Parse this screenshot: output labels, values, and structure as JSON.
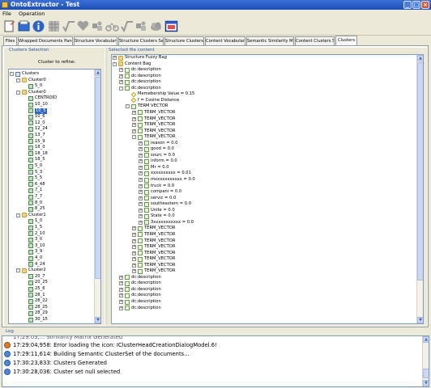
{
  "window": {
    "title": "OntoExtractor - Test"
  },
  "menu": [
    "File",
    "Operation"
  ],
  "toolbar": {
    "icons": [
      "new-document-icon",
      "open-folder-icon",
      "info-icon",
      "grid-icon",
      "sqrt-icon",
      "heart-icon",
      "puzzle-icon",
      "bike-icon",
      "sqrt-icon",
      "puzzle-icon",
      "cloud-icon",
      "window-icon"
    ]
  },
  "tabs": [
    "Files",
    "Wrapped Documents Panel",
    "Structure Vocabulary",
    "Structure Clusters Set",
    "Structure Clusters",
    "Content Vocabulary",
    "Semantic Similarity Matrix",
    "Content Clusters Set",
    "Clusters"
  ],
  "active_tab": "Clusters",
  "clusters_panel": {
    "title": "Clusters Selection",
    "refine_label": "Cluster to refine:",
    "tree": [
      {
        "level": 0,
        "label": "Clusters",
        "icon": "root",
        "exp": "-"
      },
      {
        "level": 1,
        "label": "Cluster0",
        "icon": "folder",
        "exp": "-"
      },
      {
        "level": 2,
        "label": "5_0",
        "icon": "leaf",
        "exp": ""
      },
      {
        "level": 1,
        "label": "Cluster0",
        "icon": "folder",
        "exp": "-"
      },
      {
        "level": 2,
        "label": "CENTROID",
        "icon": "leaf",
        "exp": ""
      },
      {
        "level": 2,
        "label": "10_10",
        "icon": "leaf",
        "exp": ""
      },
      {
        "level": 2,
        "label": "10_5",
        "icon": "leaf",
        "exp": "",
        "selected": true
      },
      {
        "level": 2,
        "label": "10_6",
        "icon": "leaf",
        "exp": ""
      },
      {
        "level": 2,
        "label": "12_0",
        "icon": "leaf",
        "exp": ""
      },
      {
        "level": 2,
        "label": "12_24",
        "icon": "leaf",
        "exp": ""
      },
      {
        "level": 2,
        "label": "13_7",
        "icon": "leaf",
        "exp": ""
      },
      {
        "level": 2,
        "label": "15_9",
        "icon": "leaf",
        "exp": ""
      },
      {
        "level": 2,
        "label": "18_0",
        "icon": "leaf",
        "exp": ""
      },
      {
        "level": 2,
        "label": "18_18",
        "icon": "leaf",
        "exp": ""
      },
      {
        "level": 2,
        "label": "18_5",
        "icon": "leaf",
        "exp": ""
      },
      {
        "level": 2,
        "label": "5_0",
        "icon": "leaf",
        "exp": ""
      },
      {
        "level": 2,
        "label": "5_3",
        "icon": "leaf",
        "exp": ""
      },
      {
        "level": 2,
        "label": "5_5",
        "icon": "leaf",
        "exp": ""
      },
      {
        "level": 2,
        "label": "6_48",
        "icon": "leaf",
        "exp": ""
      },
      {
        "level": 2,
        "label": "7_1",
        "icon": "leaf",
        "exp": ""
      },
      {
        "level": 2,
        "label": "7_7",
        "icon": "leaf",
        "exp": ""
      },
      {
        "level": 2,
        "label": "8_0",
        "icon": "leaf",
        "exp": ""
      },
      {
        "level": 2,
        "label": "8_25",
        "icon": "leaf",
        "exp": ""
      },
      {
        "level": 1,
        "label": "Cluster1",
        "icon": "folder",
        "exp": "-"
      },
      {
        "level": 2,
        "label": "1_0",
        "icon": "leaf",
        "exp": ""
      },
      {
        "level": 2,
        "label": "1_5",
        "icon": "leaf",
        "exp": ""
      },
      {
        "level": 2,
        "label": "2_10",
        "icon": "leaf",
        "exp": ""
      },
      {
        "level": 2,
        "label": "3_0",
        "icon": "leaf",
        "exp": ""
      },
      {
        "level": 2,
        "label": "3_10",
        "icon": "leaf",
        "exp": ""
      },
      {
        "level": 2,
        "label": "3_9",
        "icon": "leaf",
        "exp": ""
      },
      {
        "level": 2,
        "label": "4_0",
        "icon": "leaf",
        "exp": ""
      },
      {
        "level": 2,
        "label": "4_24",
        "icon": "leaf",
        "exp": ""
      },
      {
        "level": 1,
        "label": "Cluster2",
        "icon": "folder",
        "exp": "-"
      },
      {
        "level": 2,
        "label": "20_7",
        "icon": "leaf",
        "exp": ""
      },
      {
        "level": 2,
        "label": "20_25",
        "icon": "leaf",
        "exp": ""
      },
      {
        "level": 2,
        "label": "25_6",
        "icon": "leaf",
        "exp": ""
      },
      {
        "level": 2,
        "label": "28_1",
        "icon": "leaf",
        "exp": ""
      },
      {
        "level": 2,
        "label": "28_22",
        "icon": "leaf",
        "exp": ""
      },
      {
        "level": 2,
        "label": "28_25",
        "icon": "leaf",
        "exp": ""
      },
      {
        "level": 2,
        "label": "28_29",
        "icon": "leaf",
        "exp": ""
      },
      {
        "level": 2,
        "label": "30_15",
        "icon": "leaf",
        "exp": ""
      }
    ]
  },
  "content_panel": {
    "title": "Selected file content",
    "tree": [
      {
        "level": 0,
        "label": "Structure Fuzzy Bag",
        "icon": "folder",
        "exp": "+"
      },
      {
        "level": 0,
        "label": "Content Bag",
        "icon": "folder",
        "exp": "-"
      },
      {
        "level": 1,
        "label": "dc:description",
        "icon": "file",
        "exp": "+"
      },
      {
        "level": 1,
        "label": "dc:description",
        "icon": "file",
        "exp": "+"
      },
      {
        "level": 1,
        "label": "dc:description",
        "icon": "file",
        "exp": "+"
      },
      {
        "level": 1,
        "label": "dc:description",
        "icon": "file",
        "exp": "-"
      },
      {
        "level": 2,
        "label": "Memebership Value = 0.15",
        "icon": "param",
        "exp": ""
      },
      {
        "level": 2,
        "label": "f = Cosine Distance",
        "icon": "param",
        "exp": ""
      },
      {
        "level": 2,
        "label": "TERM VECTOR",
        "icon": "file",
        "exp": "-"
      },
      {
        "level": 3,
        "label": "TERM_VECTOR",
        "icon": "file",
        "exp": "+"
      },
      {
        "level": 3,
        "label": "TERM_VECTOR",
        "icon": "file",
        "exp": "+"
      },
      {
        "level": 3,
        "label": "TERM_VECTOR",
        "icon": "file",
        "exp": "+"
      },
      {
        "level": 3,
        "label": "TERM_VECTOR",
        "icon": "file",
        "exp": "+"
      },
      {
        "level": 3,
        "label": "TERM_VECTOR",
        "icon": "file",
        "exp": "-"
      },
      {
        "level": 4,
        "label": "reason = 0.0",
        "icon": "file",
        "exp": "+"
      },
      {
        "level": 4,
        "label": "good = 0.0",
        "icon": "file",
        "exp": "+"
      },
      {
        "level": 4,
        "label": "sourc = 0.0",
        "icon": "file",
        "exp": "+"
      },
      {
        "level": 4,
        "label": "inform = 0.0",
        "icon": "file",
        "exp": "+"
      },
      {
        "level": 4,
        "label": "Mr = 0.0",
        "icon": "file",
        "exp": "+"
      },
      {
        "level": 4,
        "label": "xxxxxxxxxx = 0.01",
        "icon": "file",
        "exp": "+"
      },
      {
        "level": 4,
        "label": "mxxxxxxxxxxx = 0.0",
        "icon": "file",
        "exp": "+"
      },
      {
        "level": 4,
        "label": "truck = 0.0",
        "icon": "file",
        "exp": "+"
      },
      {
        "level": 4,
        "label": "compani = 0.0",
        "icon": "file",
        "exp": "+"
      },
      {
        "level": 4,
        "label": "servic = 0.0",
        "icon": "file",
        "exp": "+"
      },
      {
        "level": 4,
        "label": "southeastern = 0.0",
        "icon": "file",
        "exp": "+"
      },
      {
        "level": 4,
        "label": "Unite = 0.0",
        "icon": "file",
        "exp": "+"
      },
      {
        "level": 4,
        "label": "State = 0.0",
        "icon": "file",
        "exp": "+"
      },
      {
        "level": 4,
        "label": "3xxxxxxxxxxx = 0.0",
        "icon": "file",
        "exp": "+"
      },
      {
        "level": 3,
        "label": "TERM_VECTOR",
        "icon": "file",
        "exp": "+"
      },
      {
        "level": 3,
        "label": "TERM_VECTOR",
        "icon": "file",
        "exp": "+"
      },
      {
        "level": 3,
        "label": "TERM_VECTOR",
        "icon": "file",
        "exp": "+"
      },
      {
        "level": 3,
        "label": "TERM_VECTOR",
        "icon": "file",
        "exp": "+"
      },
      {
        "level": 3,
        "label": "TERM_VECTOR",
        "icon": "file",
        "exp": "+"
      },
      {
        "level": 3,
        "label": "TERM_VECTOR",
        "icon": "file",
        "exp": "+"
      },
      {
        "level": 3,
        "label": "TERM_VECTOR",
        "icon": "file",
        "exp": "+"
      },
      {
        "level": 3,
        "label": "TERM_VECTOR",
        "icon": "file",
        "exp": "+"
      },
      {
        "level": 1,
        "label": "dc:description",
        "icon": "file",
        "exp": "+"
      },
      {
        "level": 1,
        "label": "dc:description",
        "icon": "file",
        "exp": "+"
      },
      {
        "level": 1,
        "label": "dc:description",
        "icon": "file",
        "exp": "+"
      },
      {
        "level": 1,
        "label": "dc:description",
        "icon": "file",
        "exp": "+"
      },
      {
        "level": 1,
        "label": "dc:description",
        "icon": "file",
        "exp": "+"
      },
      {
        "level": 1,
        "label": "dc:description",
        "icon": "file",
        "exp": "+"
      }
    ]
  },
  "log": {
    "title": "Log",
    "lines": [
      {
        "type": "error",
        "text": "17:29:04,958: Error loading the icon: IClusterHeadCreationDialogModel.6!"
      },
      {
        "type": "info",
        "text": "17:29:11,614: Building Semantic ClusterSet of the documents..."
      },
      {
        "type": "info",
        "text": "17:30:23,833: Clusters Generated"
      },
      {
        "type": "info",
        "text": "17:30:28,036: Cluster set null selected"
      }
    ]
  }
}
